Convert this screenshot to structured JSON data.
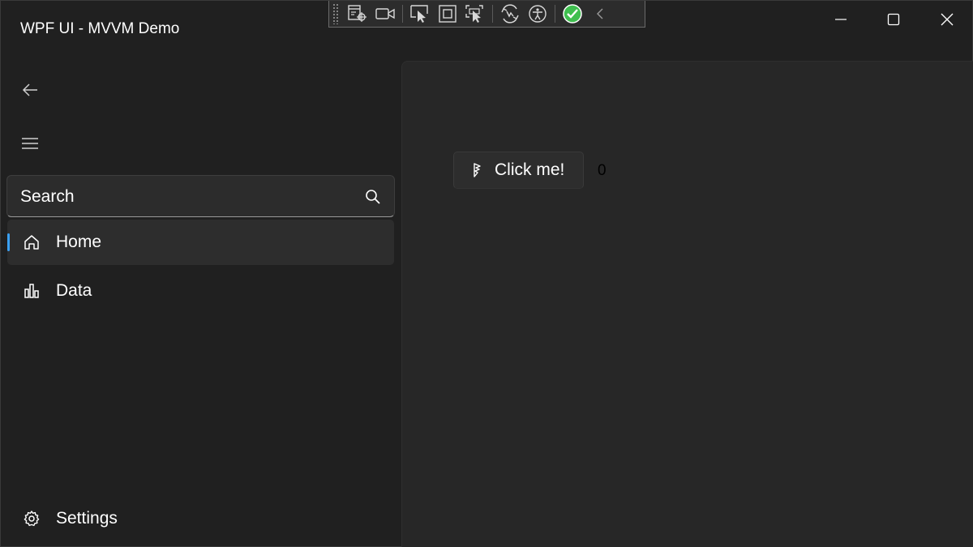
{
  "window": {
    "title": "WPF UI - MVVM Demo",
    "controls": {
      "minimize_icon": "minimize-icon",
      "maximize_icon": "maximize-icon",
      "close_icon": "close-icon"
    }
  },
  "debug_toolbar": {
    "icons": [
      "live-visual-tree-icon",
      "record-icon",
      "select-element-icon",
      "display-layout-adorners-icon",
      "track-focus-icon",
      "hot-reload-icon",
      "accessibility-icon",
      "binding-ok-icon",
      "collapse-icon"
    ]
  },
  "sidebar": {
    "back_icon": "back-arrow-icon",
    "menu_icon": "hamburger-menu-icon",
    "search": {
      "placeholder": "Search",
      "icon": "search-icon"
    },
    "items": [
      {
        "label": "Home",
        "icon": "home-icon",
        "active": true
      },
      {
        "label": "Data",
        "icon": "chart-icon",
        "active": false
      }
    ],
    "footer_items": [
      {
        "label": "Settings",
        "icon": "gear-icon"
      }
    ]
  },
  "main": {
    "button_label": "Click me!",
    "button_icon": "fluent-icon",
    "counter": "0"
  },
  "colors": {
    "background": "#202020",
    "content": "#272727",
    "accent": "#3aa0f3",
    "selected_item": "#2d2d2d",
    "status_ok": "#3fbf4f"
  }
}
